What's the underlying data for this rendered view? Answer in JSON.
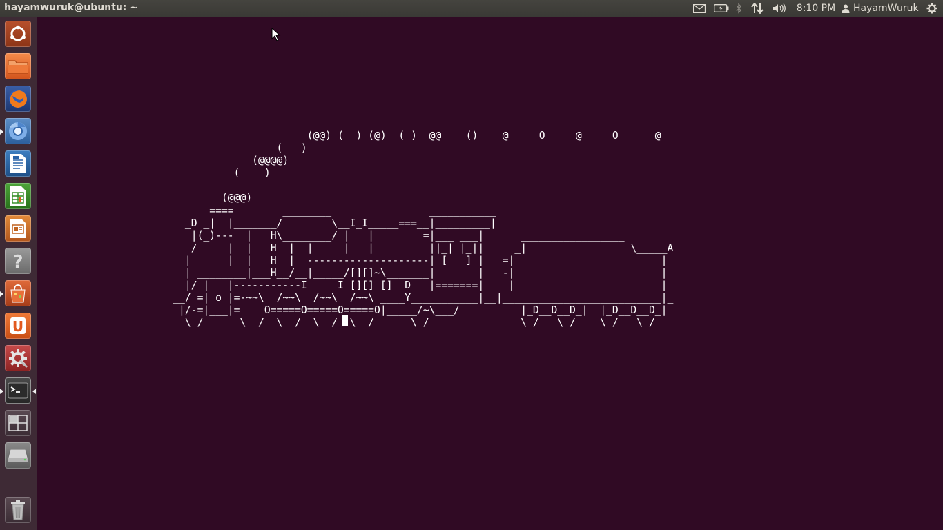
{
  "window": {
    "title": "hayamwuruk@ubuntu: ~"
  },
  "panel": {
    "clock": "8:10 PM",
    "user": "HayamWuruk",
    "indicators": [
      "mail-icon",
      "battery-icon",
      "bluetooth-icon",
      "network-icon",
      "volume-icon",
      "session-gear-icon"
    ]
  },
  "launcher": {
    "items": [
      {
        "name": "dash-home-icon"
      },
      {
        "name": "home-folder-icon"
      },
      {
        "name": "firefox-icon"
      },
      {
        "name": "chromium-icon"
      },
      {
        "name": "libreoffice-writer-icon"
      },
      {
        "name": "libreoffice-calc-icon"
      },
      {
        "name": "libreoffice-impress-icon"
      },
      {
        "name": "help-icon"
      },
      {
        "name": "software-center-icon"
      },
      {
        "name": "ubuntu-one-icon"
      },
      {
        "name": "system-settings-icon"
      },
      {
        "name": "terminal-icon"
      },
      {
        "name": "workspace-switcher-icon"
      },
      {
        "name": "disk-drive-icon"
      },
      {
        "name": "trash-icon"
      }
    ]
  },
  "terminal": {
    "lines": [
      "                           (@@) (  ) (@)  ( )  @@    ()    @     O     @     O      @",
      "                      (   )",
      "                  (@@@@)",
      "               (    )",
      "",
      "             (@@@)",
      "           ====        ________                ___________",
      "       _D _|  |_______/        \\__I_I_____===__|_________|",
      "        |(_)---  |   H\\________/ |   |        =|___ ___|      _________________",
      "        /     |  |   H  |  |     |   |         ||_| |_||     _|                 \\_____A",
      "       |      |  |   H  |__--------------------| [___] |   =|                        |",
      "       | ________|___H__/__|_____/[][]~\\_______|       |   -|                        |",
      "       |/ |   |-----------I_____I [][] []  D   |=======|____|________________________|_",
      "     __/ =| o |=-~~\\  /~~\\  /~~\\  /~~\\ ____Y___________|__|__________________________|_",
      "      |/-=|___|=    O=====O=====O=====O|_____/~\\___/          |_D__D__D_|  |_D__D__D_|",
      "       \\_/      \\__/  \\__/  \\__/  \\__/      \\_/               \\_/   \\_/    \\_/   \\_/"
    ]
  }
}
